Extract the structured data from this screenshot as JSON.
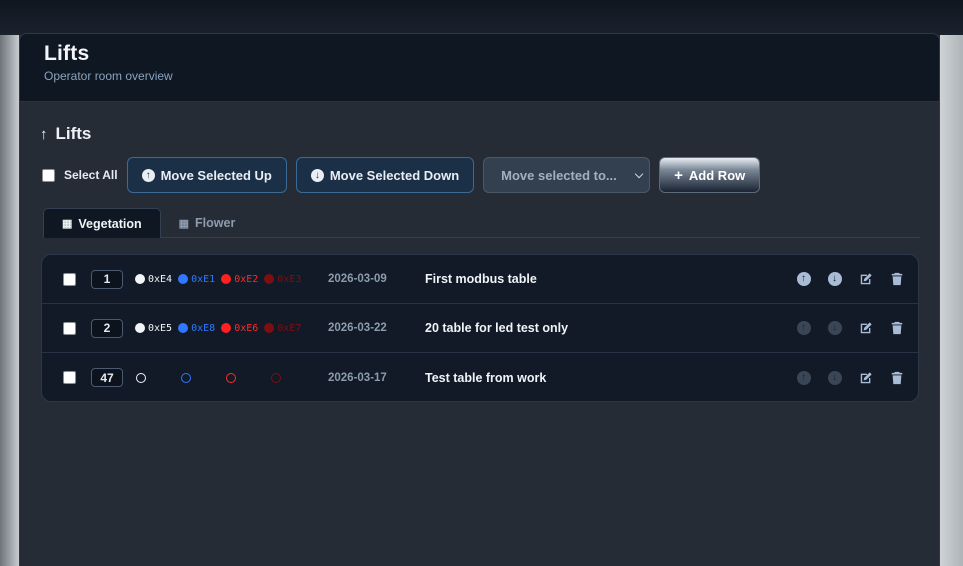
{
  "header": {
    "title": "Lifts",
    "subtitle": "Operator room overview"
  },
  "section": {
    "title": "Lifts",
    "arrow_glyph": "↑"
  },
  "toolbar": {
    "select_all_label": "Select All",
    "move_up_label": "Move Selected Up",
    "move_down_label": "Move Selected Down",
    "move_to_placeholder": "Move selected to...",
    "add_row_label": "Add Row"
  },
  "tabs": [
    {
      "label": "Vegetation",
      "active": true
    },
    {
      "label": "Flower",
      "active": false
    }
  ],
  "rows": [
    {
      "num": "1",
      "addresses": [
        "0xE4",
        "0xE1",
        "0xE2",
        "0xE3"
      ],
      "date": "2026-03-09",
      "name": "First modbus table",
      "move_up_enabled": true,
      "move_down_enabled": true
    },
    {
      "num": "2",
      "addresses": [
        "0xE5",
        "0xE8",
        "0xE6",
        "0xE7"
      ],
      "date": "2026-03-22",
      "name": "20 table for led test only",
      "move_up_enabled": false,
      "move_down_enabled": false
    },
    {
      "num": "47",
      "addresses": [
        "",
        "",
        "",
        ""
      ],
      "date": "2026-03-17",
      "name": "Test table from work",
      "move_up_enabled": false,
      "move_down_enabled": false
    }
  ],
  "colors": {
    "address_white": "#f2f5f8",
    "address_blue": "#2f78ff",
    "address_red": "#ff2a2a",
    "address_dark_red": "#7d0f12",
    "accent_border": "#3a6a95"
  },
  "icons": {
    "up": "arrow-up-circle-icon",
    "down": "arrow-down-circle-icon",
    "edit": "edit-icon",
    "delete": "trash-icon",
    "tab": "grid-icon"
  }
}
